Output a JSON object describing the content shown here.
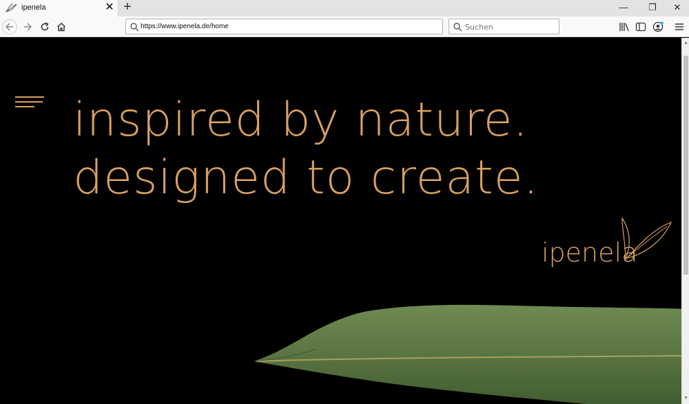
{
  "browser": {
    "tab_title": "ipenela",
    "tab_close": "✕",
    "new_tab": "+",
    "url": "https://www.ipenela.de/home",
    "search_placeholder": "Suchen",
    "window_minimize": "—",
    "window_restore": "❐",
    "window_close": "✕"
  },
  "page": {
    "headline_line1": "inspired by nature.",
    "headline_line2": "designed to create.",
    "logo_text": "ipenela"
  },
  "colors": {
    "accent_gold": "#d9a15f",
    "background": "#000000",
    "leaf_green": "#5f7a45"
  },
  "icons": [
    "back-icon",
    "forward-icon",
    "reload-icon",
    "home-icon",
    "library-icon",
    "sidebar-icon",
    "account-icon",
    "menu-icon",
    "hamburger-menu-icon",
    "search-icon"
  ]
}
